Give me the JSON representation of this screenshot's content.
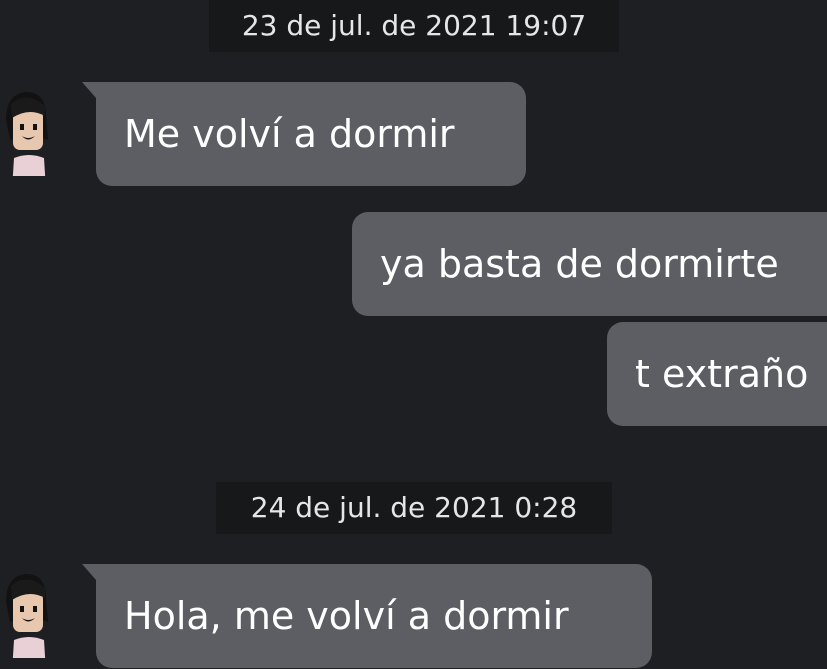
{
  "colors": {
    "background": "#1e1f22",
    "bubble": "#5d5e63",
    "timestamp_bg": "#17181a",
    "text": "#ffffff"
  },
  "messages": [
    {
      "type": "timestamp",
      "text": "23 de jul. de 2021 19:07"
    },
    {
      "type": "incoming",
      "avatar": "avatar-icon",
      "text": "Me volví a dormir"
    },
    {
      "type": "outgoing",
      "text": "ya basta de dormirte"
    },
    {
      "type": "outgoing",
      "text": "t extraño"
    },
    {
      "type": "timestamp",
      "text": "24 de jul. de 2021 0:28"
    },
    {
      "type": "incoming",
      "avatar": "avatar-icon",
      "text": "Hola, me volví a dormir"
    }
  ]
}
